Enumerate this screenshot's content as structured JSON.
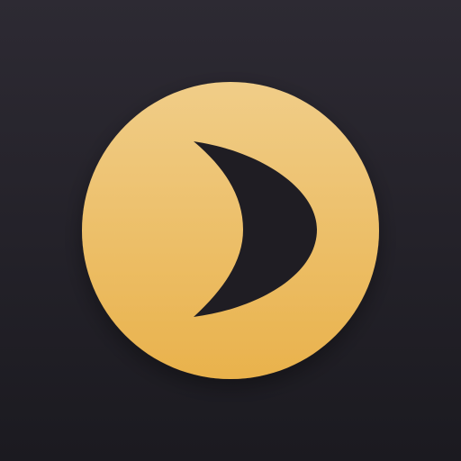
{
  "icon": {
    "name": "crescent-moon-app-icon",
    "symbol": "crescent-moon-icon",
    "colors": {
      "background_top": "#2d2a33",
      "background_bottom": "#1b1a20",
      "disc_top": "#f0cd88",
      "disc_bottom": "#e9b24c",
      "crescent": "#1f1d23"
    }
  }
}
